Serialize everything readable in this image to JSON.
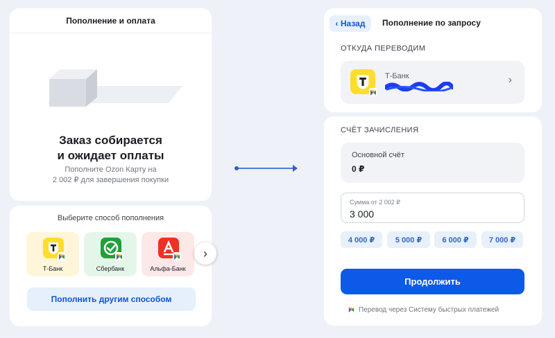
{
  "left": {
    "header": "Пополнение и оплата",
    "title_line1": "Заказ собирается",
    "title_line2": "и ожидает оплаты",
    "desc_line1": "Пополните Ozon Карту на",
    "desc_line2": "2 002 ₽ для завершения покупки",
    "choose_label": "Выберите способ пополнения",
    "banks": [
      {
        "name": "Т-Банк",
        "bg": "#fff6d9",
        "logo_color": "#ffdd2d"
      },
      {
        "name": "Сбербанк",
        "bg": "#e4f6ea",
        "logo_color": "#21a038"
      },
      {
        "name": "Альфа-Банк",
        "bg": "#fde8e8",
        "logo_color": "#ef3124"
      }
    ],
    "next_icon": "›",
    "other_method": "Пополнить другим способом"
  },
  "right": {
    "back": "‹ Назад",
    "header": "Пополнение по запросу",
    "from_label": "ОТКУДА ПЕРЕВОДИМ",
    "from_bank": "Т-Банк",
    "from_chevron": "›",
    "to_label": "СЧЁТ ЗАЧИСЛЕНИЯ",
    "account_name": "Основной счёт",
    "account_balance": "0 ₽",
    "amount_placeholder": "Сумма от 2 002 ₽",
    "amount_value": "3 000",
    "chips": [
      "4 000 ₽",
      "5 000 ₽",
      "6 000 ₽",
      "7 000 ₽"
    ],
    "continue": "Продолжить",
    "sbp_note": "Перевод через Систему быстрых платежей"
  },
  "colors": {
    "accent": "#0d5ae8",
    "tbank_yellow": "#ffdd2d",
    "sber_green": "#21a038",
    "alfa_red": "#ef3124"
  }
}
